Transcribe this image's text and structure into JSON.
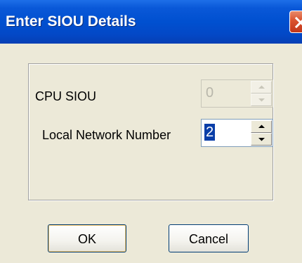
{
  "dialog": {
    "title": "Enter SIOU Details",
    "close_icon": "close-icon"
  },
  "fields": {
    "cpu_siou": {
      "label": "CPU SIOU",
      "value": "0",
      "enabled": false
    },
    "local_network_number": {
      "label": "Local Network Number",
      "value": "2",
      "enabled": true
    }
  },
  "buttons": {
    "ok": "OK",
    "cancel": "Cancel"
  },
  "colors": {
    "titlebar": "#0050d0",
    "dialog_background": "#ece9d8",
    "close_button": "#d9522e"
  }
}
